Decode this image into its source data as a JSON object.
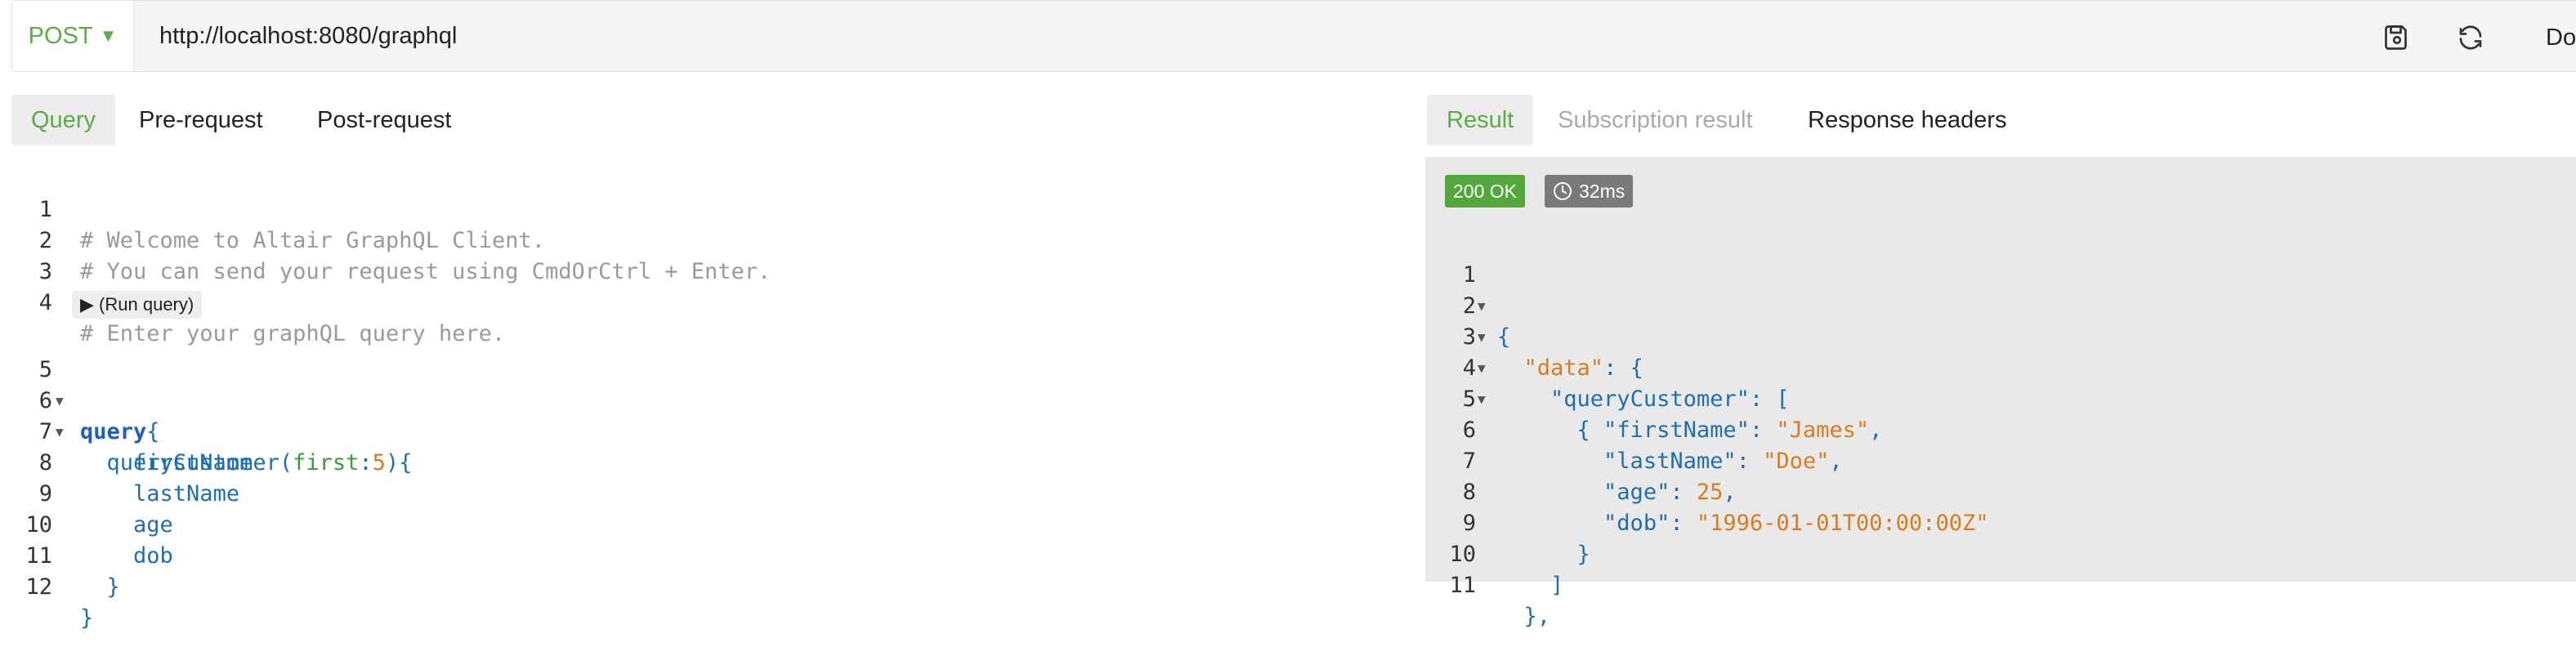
{
  "toolbar": {
    "method": "POST",
    "url": "http://localhost:8080/graphql",
    "docs_label": "Doc"
  },
  "icons": [
    "save-icon",
    "refresh-icon",
    "clock-icon",
    "caret-down-icon"
  ],
  "colors": {
    "accent": "#5aac44",
    "status_ok": "#52a83a",
    "time_badge": "#7a7a7a"
  },
  "query_tabs": [
    {
      "label": "Query",
      "active": true
    },
    {
      "label": "Pre-request"
    },
    {
      "label": "Post-request"
    }
  ],
  "result_tabs": [
    {
      "label": "Result",
      "active": true
    },
    {
      "label": "Subscription result",
      "disabled": true
    },
    {
      "label": "Response headers"
    }
  ],
  "editor": {
    "run_query_label": "(Run query)",
    "lines": [
      {
        "n": "1",
        "text": "# Welcome to Altair GraphQL Client."
      },
      {
        "n": "2",
        "text": "# You can send your request using CmdOrCtrl + Enter."
      },
      {
        "n": "3",
        "text": ""
      },
      {
        "n": "4",
        "text": "# Enter your graphQL query here."
      },
      {
        "n": "5",
        "kw": "query",
        "punc": "{"
      },
      {
        "n": "6",
        "fn": "queryCustomer",
        "open": "(",
        "arg": "first",
        "colon": ":",
        "num": "5",
        "close": "){"
      },
      {
        "n": "7",
        "text": "firstName"
      },
      {
        "n": "8",
        "text": "lastName"
      },
      {
        "n": "9",
        "text": "age"
      },
      {
        "n": "10",
        "text": "dob"
      },
      {
        "n": "11",
        "text": "}"
      },
      {
        "n": "12",
        "text": "}"
      }
    ]
  },
  "result": {
    "status": "200 OK",
    "time": "32ms",
    "lines": [
      {
        "n": "1",
        "text": "{"
      },
      {
        "n": "2",
        "key": "\"data\"",
        "rest": ": {"
      },
      {
        "n": "3",
        "key": "\"queryCustomer\"",
        "rest": ": ["
      },
      {
        "n": "4",
        "text": "{"
      },
      {
        "n": "5",
        "key": "\"firstName\"",
        "sep": ": ",
        "val": "\"James\"",
        "end": ","
      },
      {
        "n": "6",
        "key": "\"lastName\"",
        "sep": ": ",
        "val": "\"Doe\"",
        "end": ","
      },
      {
        "n": "7",
        "key": "\"age\"",
        "sep": ": ",
        "val": "25",
        "end": ","
      },
      {
        "n": "8",
        "key": "\"dob\"",
        "sep": ": ",
        "val": "\"1996-01-01T00:00:00Z\""
      },
      {
        "n": "9",
        "text": "}"
      },
      {
        "n": "10",
        "text": "]"
      },
      {
        "n": "11",
        "text": "},"
      }
    ]
  }
}
